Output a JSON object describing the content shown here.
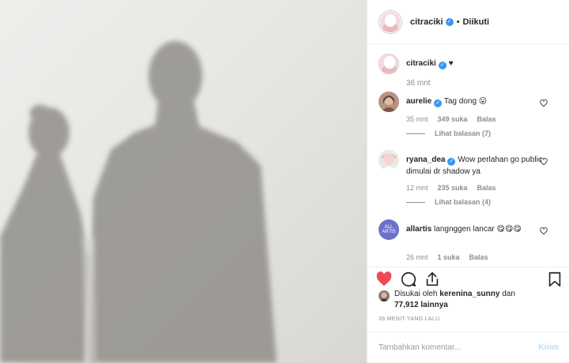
{
  "post_author": {
    "username": "citraciki",
    "follow_status": "Diikuti",
    "dot": "•"
  },
  "caption": {
    "username": "citraciki",
    "text": "♥",
    "time": "36 mnt"
  },
  "comments": [
    {
      "username": "aurelie",
      "text": "Tag dong 😛",
      "time": "35 mnt",
      "likes": "349 suka",
      "reply_label": "Balas",
      "view_replies": "Lihat balasan (7)",
      "avatar_color": "#b89382"
    },
    {
      "username": "ryana_dea",
      "text": "Wow perlahan go public dimulai dr shadow ya",
      "time": "12 mnt",
      "likes": "235 suka",
      "reply_label": "Balas",
      "view_replies": "Lihat balasan (4)",
      "avatar_color": "#e8e3e6"
    },
    {
      "username": "allartis",
      "text": "langnggen lancar 😋😋😋",
      "time": "26 mnt",
      "likes": "1 suka",
      "reply_label": "Balas",
      "avatar_text": "ALL ARTIS",
      "avatar_color": "#6a72c9"
    }
  ],
  "actions": {
    "like_icon": "heart-filled-icon",
    "comment_icon": "comment-icon",
    "share_icon": "share-icon",
    "save_icon": "bookmark-icon",
    "like_color": "#ed4956"
  },
  "likes": {
    "prefix": "Disukai oleh ",
    "user": "kerenina_sunny",
    "conj": " dan",
    "count": "77,912 lainnya"
  },
  "timestamp": "36 MENIT YANG LALU",
  "add_comment": {
    "placeholder": "Tambahkan komentar...",
    "post_label": "Kirim"
  },
  "colors": {
    "verified": "#3897f0",
    "muted": "#8e8e8e",
    "post_disabled": "#b2dffc"
  }
}
